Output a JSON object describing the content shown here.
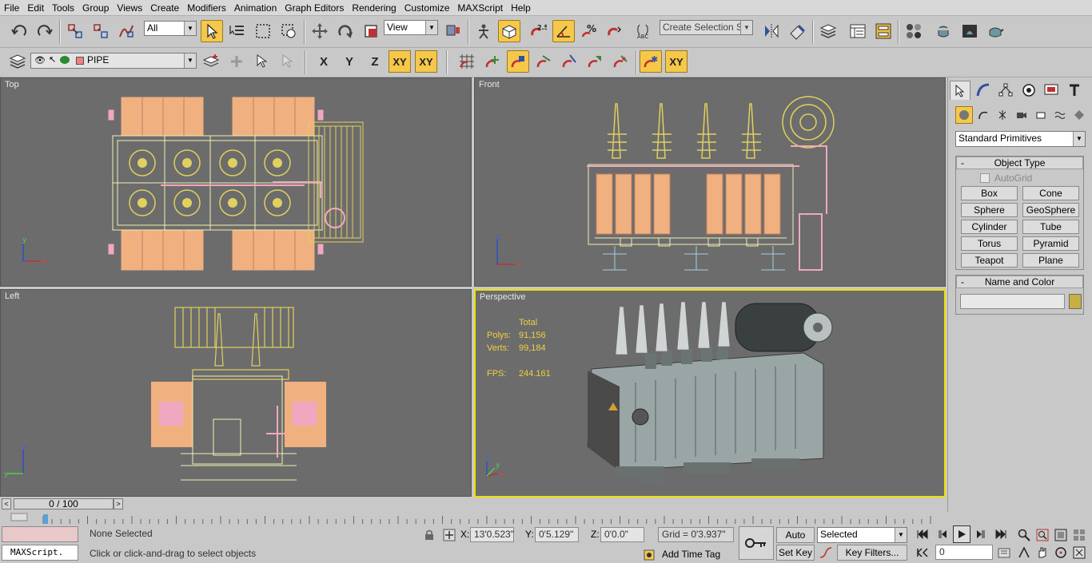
{
  "menu": [
    "File",
    "Edit",
    "Tools",
    "Group",
    "Views",
    "Create",
    "Modifiers",
    "Animation",
    "Graph Editors",
    "Rendering",
    "Customize",
    "MAXScript",
    "Help"
  ],
  "toolbar": {
    "selection_filter": "All",
    "reference_coord": "View",
    "snap_angle_label": "2.5",
    "selection_set_placeholder": "Create Selection Set",
    "axis_x": "X",
    "axis_y": "Y",
    "axis_z": "Z",
    "axis_xy": "XY",
    "axis_xy2": "XY",
    "axis_xy_constraint": "XY"
  },
  "layer": {
    "name": "PIPE"
  },
  "viewports": {
    "top": {
      "label": "Top"
    },
    "front": {
      "label": "Front"
    },
    "left": {
      "label": "Left"
    },
    "perspective": {
      "label": "Perspective",
      "stats_header": "Total",
      "polys_label": "Polys:",
      "polys": "91,156",
      "verts_label": "Verts:",
      "verts": "99,184",
      "fps_label": "FPS:",
      "fps": "244.161"
    },
    "axis_x": "x",
    "axis_y": "y",
    "axis_z": "z"
  },
  "command_panel": {
    "category": "Standard Primitives",
    "object_type_title": "Object Type",
    "autogrid": "AutoGrid",
    "primitives": [
      "Box",
      "Cone",
      "Sphere",
      "GeoSphere",
      "Cylinder",
      "Tube",
      "Torus",
      "Pyramid",
      "Teapot",
      "Plane"
    ],
    "name_color_title": "Name and Color",
    "name_value": ""
  },
  "time": {
    "frame_display": "0 / 100"
  },
  "status": {
    "maxscript_label": "MAXScript.",
    "selection_text": "None Selected",
    "prompt_text": "Click or click-and-drag to select objects",
    "x_label": "X:",
    "x_value": "13'0.523\"",
    "y_label": "Y:",
    "y_value": "0'5.129\"",
    "z_label": "Z:",
    "z_value": "0'0.0\"",
    "grid_text": "Grid = 0'3.937\"",
    "add_time_tag": "Add Time Tag",
    "auto_key": "Auto Key",
    "set_key": "Set Key",
    "key_mode": "Selected",
    "key_filters": "Key Filters...",
    "current_frame": "0"
  },
  "colors": {
    "accent": "#f5c84a",
    "viewport_bg": "#6c6c6c",
    "wire_yellow": "#e0d060",
    "wire_orange": "#f0b080",
    "wire_pink": "#f0a8c0",
    "active_border": "#f0e000"
  }
}
